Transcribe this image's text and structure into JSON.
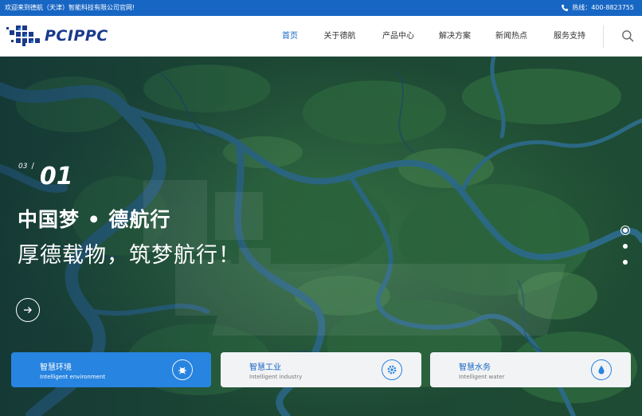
{
  "topbar": {
    "welcome": "欢迎来到德航（天津）智能科技有限公司官网!",
    "hotline_label": "热线：",
    "hotline_number": "400-8823755",
    "background": "#1766c4"
  },
  "logo": {
    "text": "PCIPPC"
  },
  "nav": {
    "items": [
      {
        "label": "首页",
        "active": true
      },
      {
        "label": "关于德航",
        "active": false
      },
      {
        "label": "产品中心",
        "active": false
      },
      {
        "label": "解决方案",
        "active": false
      },
      {
        "label": "新闻热点",
        "active": false
      },
      {
        "label": "服务支持",
        "active": false
      }
    ],
    "active_color": "#1766c4"
  },
  "hero": {
    "slide_total": "03",
    "slide_separator": "/",
    "slide_current": "01",
    "title": "中国梦 • 德航行",
    "subtitle": "厚德载物，筑梦航行！",
    "slide_count": 3,
    "active_slide_index": 0
  },
  "cards": [
    {
      "title": "智慧环境",
      "subtitle": "Intelligent environment",
      "icon": "environment-icon",
      "active": true
    },
    {
      "title": "智慧工业",
      "subtitle": "Intelligent industry",
      "icon": "industry-gear-icon",
      "active": false
    },
    {
      "title": "智慧水务",
      "subtitle": "Intelligent water",
      "icon": "water-drop-icon",
      "active": false
    }
  ],
  "colors": {
    "primary": "#1766c4",
    "card_active": "#2784e0",
    "card_inactive": "#f2f3f5"
  }
}
